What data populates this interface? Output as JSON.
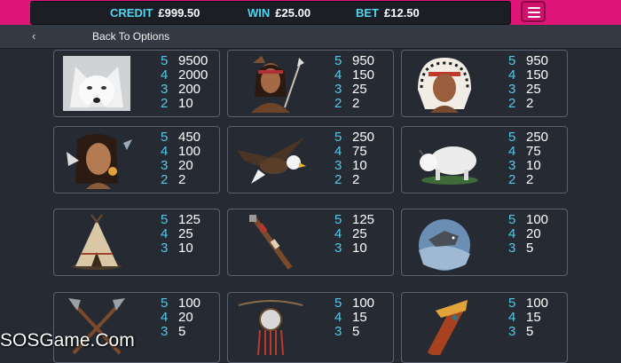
{
  "header": {
    "credit_label": "CREDIT",
    "credit_value": "£999.50",
    "win_label": "WIN",
    "win_value": "£25.00",
    "bet_label": "BET",
    "bet_value": "£12.50"
  },
  "nav": {
    "back_arrow": "‹",
    "back_label": "Back To Options"
  },
  "paytable": [
    {
      "symbol": "white-wolf",
      "pays": [
        [
          "5",
          "9500"
        ],
        [
          "4",
          "2000"
        ],
        [
          "3",
          "200"
        ],
        [
          "2",
          "10"
        ]
      ]
    },
    {
      "symbol": "native-warrior",
      "pays": [
        [
          "5",
          "950"
        ],
        [
          "4",
          "150"
        ],
        [
          "3",
          "25"
        ],
        [
          "2",
          "2"
        ]
      ]
    },
    {
      "symbol": "native-chief",
      "pays": [
        [
          "5",
          "950"
        ],
        [
          "4",
          "150"
        ],
        [
          "3",
          "25"
        ],
        [
          "2",
          "2"
        ]
      ]
    },
    {
      "symbol": "native-woman",
      "pays": [
        [
          "5",
          "450"
        ],
        [
          "4",
          "100"
        ],
        [
          "3",
          "20"
        ],
        [
          "2",
          "2"
        ]
      ]
    },
    {
      "symbol": "eagle",
      "pays": [
        [
          "5",
          "250"
        ],
        [
          "4",
          "75"
        ],
        [
          "3",
          "10"
        ],
        [
          "2",
          "2"
        ]
      ]
    },
    {
      "symbol": "white-buffalo",
      "pays": [
        [
          "5",
          "250"
        ],
        [
          "4",
          "75"
        ],
        [
          "3",
          "10"
        ],
        [
          "2",
          "2"
        ]
      ]
    },
    {
      "symbol": "tipi",
      "pays": [
        [
          "5",
          "125"
        ],
        [
          "4",
          "25"
        ],
        [
          "3",
          "10"
        ]
      ]
    },
    {
      "symbol": "pipe",
      "pays": [
        [
          "5",
          "125"
        ],
        [
          "4",
          "25"
        ],
        [
          "3",
          "10"
        ]
      ]
    },
    {
      "symbol": "wolf-moon",
      "pays": [
        [
          "5",
          "100"
        ],
        [
          "4",
          "20"
        ],
        [
          "3",
          "5"
        ]
      ]
    },
    {
      "symbol": "tomahawks",
      "pays": [
        [
          "5",
          "100"
        ],
        [
          "4",
          "20"
        ],
        [
          "3",
          "5"
        ]
      ]
    },
    {
      "symbol": "dreamcatcher",
      "pays": [
        [
          "5",
          "100"
        ],
        [
          "4",
          "15"
        ],
        [
          "3",
          "5"
        ]
      ]
    },
    {
      "symbol": "totem",
      "pays": [
        [
          "5",
          "100"
        ],
        [
          "4",
          "15"
        ],
        [
          "3",
          "5"
        ]
      ]
    }
  ],
  "watermark": "SOSGame.Com"
}
